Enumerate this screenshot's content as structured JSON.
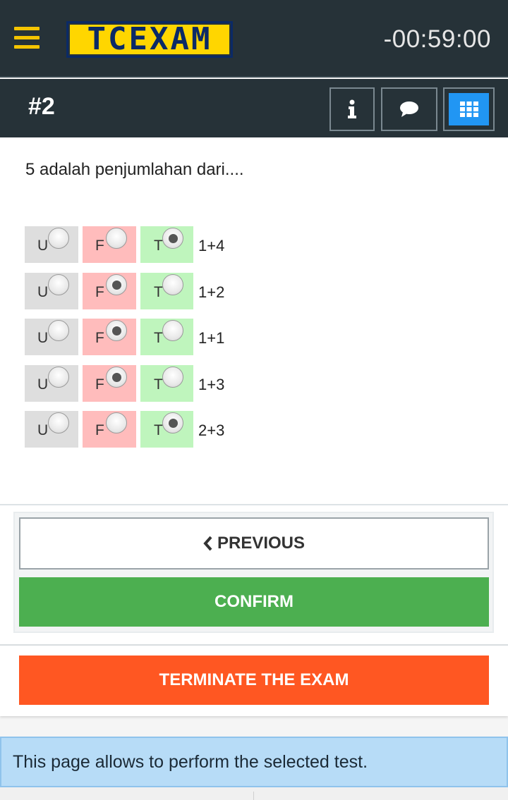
{
  "header": {
    "logo_text": "TCEXAM",
    "timer": "-00:59:00"
  },
  "question_bar": {
    "number": "#2",
    "info_icon": "info-icon",
    "comment_icon": "comment-icon",
    "grid_icon": "grid-icon",
    "accent_color": "#2196f3"
  },
  "question": {
    "text": "5 adalah penjumlahan dari....",
    "option_labels": {
      "u": "U",
      "f": "F",
      "t": "T"
    },
    "answers": [
      {
        "text": "1+4",
        "selected": "T"
      },
      {
        "text": "1+2",
        "selected": "F"
      },
      {
        "text": "1+1",
        "selected": "F"
      },
      {
        "text": "1+3",
        "selected": "F"
      },
      {
        "text": "2+3",
        "selected": "T"
      }
    ]
  },
  "navigation": {
    "previous_label": "PREVIOUS",
    "previous_icon": "chevron-left-icon",
    "confirm_label": "CONFIRM",
    "confirm_color": "#4caf50"
  },
  "terminate": {
    "label": "TERMINATE THE EXAM",
    "color": "#ff5722"
  },
  "info": {
    "message": "This page allows to perform the selected test."
  }
}
